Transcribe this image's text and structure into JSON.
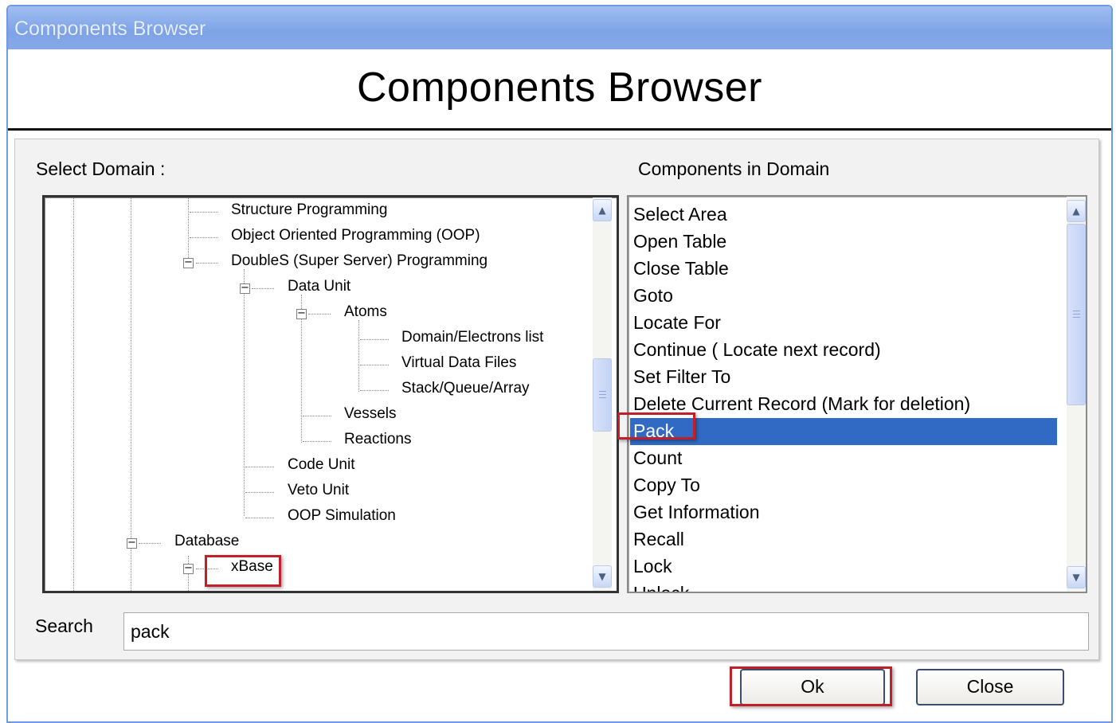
{
  "window": {
    "title": "Components Browser"
  },
  "header": {
    "title": "Components Browser"
  },
  "domain": {
    "label": "Select Domain :",
    "tree": [
      {
        "label": "Structure Programming"
      },
      {
        "label": "Object Oriented Programming (OOP)"
      },
      {
        "label": "DoubleS (Super Server) Programming",
        "expanded": true
      },
      {
        "label": "Data Unit",
        "expanded": true
      },
      {
        "label": "Atoms",
        "expanded": true
      },
      {
        "label": "Domain/Electrons list"
      },
      {
        "label": "Virtual Data Files"
      },
      {
        "label": "Stack/Queue/Array"
      },
      {
        "label": "Vessels"
      },
      {
        "label": "Reactions"
      },
      {
        "label": "Code Unit"
      },
      {
        "label": "Veto Unit"
      },
      {
        "label": "OOP Simulation"
      },
      {
        "label": "Database",
        "expanded": true
      },
      {
        "label": "xBase",
        "expanded": true,
        "highlighted": true
      }
    ]
  },
  "components": {
    "label": "Components in Domain",
    "items": [
      {
        "label": "Select Area"
      },
      {
        "label": "Open Table"
      },
      {
        "label": "Close Table"
      },
      {
        "label": "Goto"
      },
      {
        "label": "Locate For"
      },
      {
        "label": "Continue ( Locate next record)"
      },
      {
        "label": "Set Filter To"
      },
      {
        "label": "Delete Current Record (Mark for deletion)"
      },
      {
        "label": "Pack",
        "selected": true
      },
      {
        "label": "Count"
      },
      {
        "label": "Copy To"
      },
      {
        "label": "Get Information"
      },
      {
        "label": "Recall"
      },
      {
        "label": "Lock"
      },
      {
        "label": "Unlock"
      }
    ]
  },
  "search": {
    "label": "Search",
    "value": "pack"
  },
  "buttons": {
    "ok": "Ok",
    "close": "Close"
  },
  "colors": {
    "selection": "#316ac5",
    "highlight_box": "#c0202a",
    "titlebar": "#7ea3e6"
  },
  "icons": {
    "scroll_up": "chevron-up-icon",
    "scroll_down": "chevron-down-icon",
    "tree_toggle": "minus-box-icon"
  }
}
